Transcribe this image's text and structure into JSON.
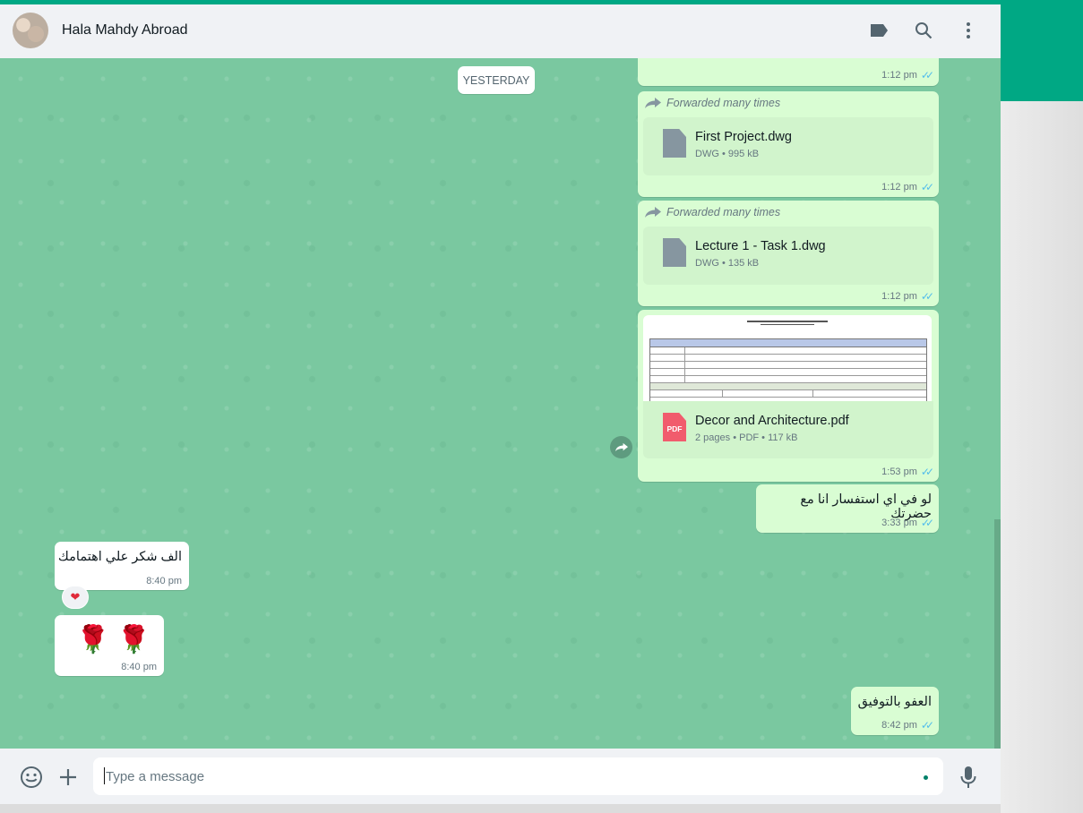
{
  "colors": {
    "accent": "#00a884",
    "outgoing_bubble": "#d9fdd3",
    "incoming_bubble": "#ffffff",
    "chat_background": "#7ac8a0",
    "read_ticks": "#53bdeb"
  },
  "header": {
    "contact_name": "Hala Mahdy Abroad",
    "icons": [
      "label-icon",
      "search-icon",
      "menu-icon"
    ]
  },
  "chat": {
    "date_divider": "YESTERDAY",
    "messages": [
      {
        "direction": "out",
        "type": "partial",
        "time": "1:12 pm",
        "status": "read"
      },
      {
        "direction": "out",
        "type": "document",
        "forwarded": "Forwarded many times",
        "file_name": "First Project.dwg",
        "file_info": "DWG • 995 kB",
        "time": "1:12 pm",
        "status": "read"
      },
      {
        "direction": "out",
        "type": "document",
        "forwarded": "Forwarded many times",
        "file_name": "Lecture 1 - Task 1.dwg",
        "file_info": "DWG • 135 kB",
        "time": "1:12 pm",
        "status": "read"
      },
      {
        "direction": "out",
        "type": "pdf",
        "file_name": "Decor and Architecture.pdf",
        "file_info": "2 pages • PDF • 117 kB",
        "badge": "PDF",
        "time": "1:53 pm",
        "status": "read"
      },
      {
        "direction": "out",
        "type": "text",
        "text": "لو في اي استفسار انا مع حضرتك",
        "time": "3:33 pm",
        "status": "read"
      },
      {
        "direction": "in",
        "type": "text",
        "text": "الف شكر علي اهتمامك",
        "time": "8:40 pm",
        "reaction": "❤"
      },
      {
        "direction": "in",
        "type": "emoji",
        "text": "🌹 🌹",
        "time": "8:40 pm"
      },
      {
        "direction": "out",
        "type": "text",
        "text": "العفو بالتوفيق",
        "time": "8:42 pm",
        "status": "read"
      }
    ]
  },
  "footer": {
    "placeholder": "Type a message",
    "icons": [
      "emoji-icon",
      "attach-plus-icon",
      "microphone-icon"
    ]
  }
}
